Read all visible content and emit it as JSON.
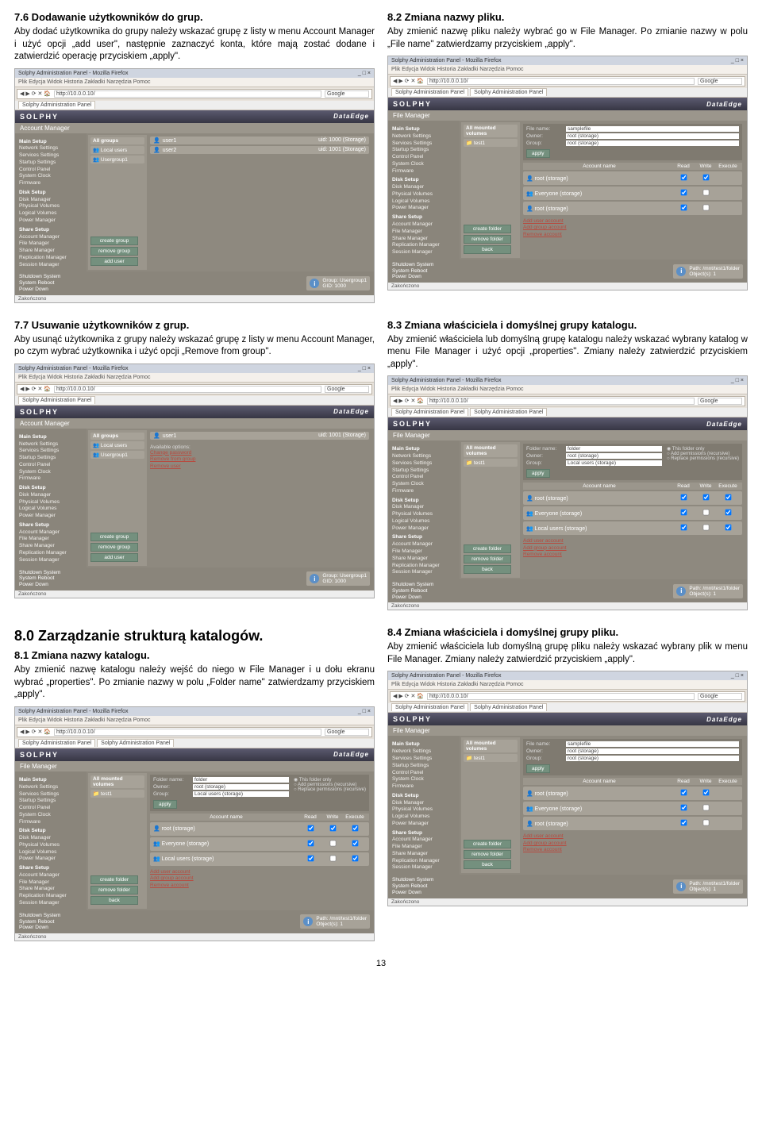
{
  "sec": {
    "s76_title": "7.6 Dodawanie użytkowników do grup.",
    "s76_body": "Aby dodać użytkownika do grupy należy wskazać grupę z listy w menu Account Manager i użyć opcji „add user\", następnie zaznaczyć konta, które mają zostać dodane i zatwierdzić operację przyciskiem „apply\".",
    "s77_title": "7.7 Usuwanie użytkowników z grup.",
    "s77_body": "Aby usunąć użytkownika z grupy należy wskazać grupę z listy w menu Account Manager, po czym wybrać użytkownika i użyć opcji „Remove from group\".",
    "s80_title": "8.0 Zarządzanie strukturą katalogów.",
    "s81_title": "8.1 Zmiana nazwy katalogu.",
    "s81_body": "Aby zmienić nazwę katalogu należy wejść do niego w File Manager i u dołu ekranu wybrać „properties\". Po zmianie nazwy w polu „Folder name\" zatwierdzamy przyciskiem „apply\".",
    "s82_title": "8.2 Zmiana nazwy pliku.",
    "s82_body": "Aby zmienić nazwę pliku należy wybrać go w File Manager. Po zmianie nazwy w polu „File name\" zatwierdzamy przyciskiem „apply\".",
    "s83_title": "8.3 Zmiana właściciela i domyślnej grupy katalogu.",
    "s83_body": "Aby zmienić właściciela lub domyślną grupę katalogu należy wskazać wybrany katalog w menu File Manager i użyć opcji „properties\". Zmiany należy zatwierdzić przyciskiem „apply\".",
    "s84_title": "8.4 Zmiana właściciela i domyślnej grupy pliku.",
    "s84_body": "Aby zmienić właściciela lub domyślną grupę pliku należy wskazać wybrany plik w menu File Manager. Zmiany należy zatwierdzić przyciskiem „apply\"."
  },
  "ff": {
    "title": "Solphy Administration Panel - Mozilla Firefox",
    "menu": "Plik  Edycja  Widok  Historia  Zakładki  Narzędzia  Pomoc",
    "addr": "http://10.0.0.10/",
    "search": "Google",
    "tab": "Solphy Administration Panel",
    "status": "Zakończono"
  },
  "app": {
    "brand": "SOLPHY",
    "product": "DataEdge",
    "acct_mgr": "Account Manager",
    "file_mgr": "File Manager"
  },
  "side": {
    "main_setup": "Main Setup",
    "main_items": [
      "Network Settings",
      "Services Settings",
      "Startup Settings",
      "Control Panel",
      "System Clock",
      "Firmware"
    ],
    "disk_setup": "Disk Setup",
    "disk_items": [
      "Disk Manager",
      "Physical Volumes",
      "Logical Volumes",
      "Power Manager"
    ],
    "share_setup": "Share Setup",
    "share_items": [
      "Account Manager",
      "File Manager",
      "Share Manager",
      "Replication Manager",
      "Session Manager"
    ],
    "shutdown": [
      "Shutdown System",
      "System Reboot",
      "Power Down"
    ]
  },
  "acct": {
    "groups_head": "All groups",
    "local_users": "Local users",
    "usergroup1": "Usergroup1",
    "user1": "user1",
    "user2": "user2",
    "uid1": "uid: 1000  (Storage)",
    "uid2": "uid: 1001  (Storage)",
    "btn_create": "create group",
    "btn_remove": "remove group",
    "btn_add": "add user",
    "avail_opts": "Available options:",
    "change_pw": "Change password",
    "remove_from_group": "Remove from group",
    "remove_user": "Remove user",
    "group_lbl": "Group:",
    "group_val": "Usergroup1",
    "gid_lbl": "GID:",
    "gid_val": "1000"
  },
  "fm": {
    "all_vol": "All mounted volumes",
    "test1": "test1",
    "folder_name": "Folder name:",
    "file_name": "File name:",
    "owner": "Owner:",
    "group": "Group:",
    "folder_val": "folder",
    "file_val": "samplefile",
    "owner_val": "root (storage)",
    "group_val": "Local users (storage)",
    "apply": "apply",
    "this_only": "This folder only",
    "add_perm": "Add permissions (recursive)",
    "replace_perm": "Replace permissions (recursive)",
    "acct_name": "Account name",
    "read": "Read",
    "write": "Write",
    "exec": "Execute",
    "root": "root (storage)",
    "everyone": "Everyone  (storage)",
    "localu": "Local users  (storage)",
    "add_user_acct": "Add user account",
    "add_group_acct": "Add group account",
    "remove_acct": "Remove account",
    "create_folder": "create folder",
    "remove_folder": "remove folder",
    "back": "back",
    "path_lbl": "Path:",
    "path_val": "/mnt/test1/folder",
    "obj_lbl": "Object(s):",
    "obj_val": "1"
  },
  "page_number": "13"
}
